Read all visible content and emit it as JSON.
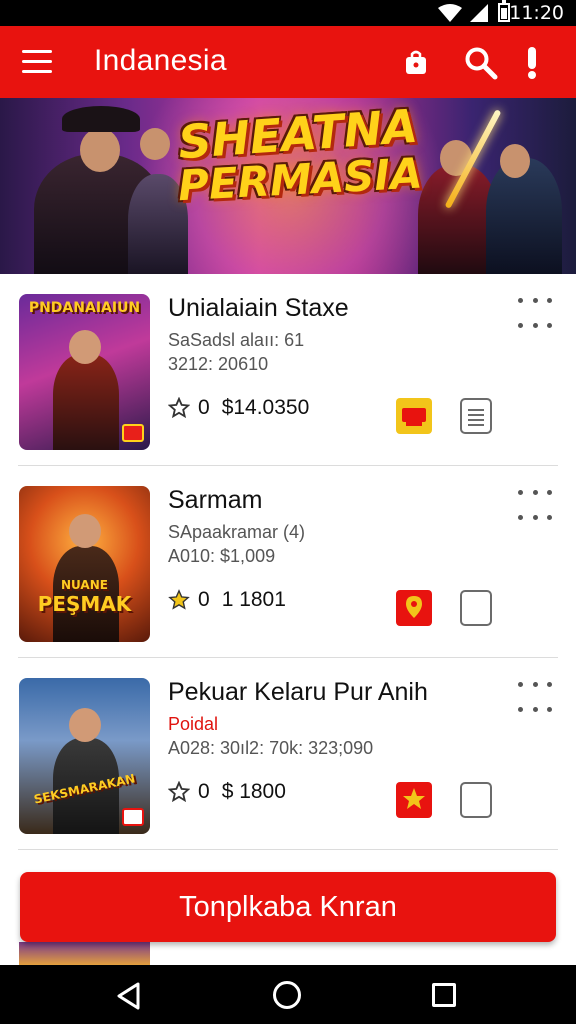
{
  "status_bar": {
    "time": "11:20"
  },
  "app_bar": {
    "title": "Indanesia"
  },
  "banner": {
    "title_line1": "SHEATNA",
    "title_line2": "PERMASIA"
  },
  "items": [
    {
      "name": "Unialaiain Staxe",
      "sub1": "SaSadsl alaıı: 61",
      "sub2": "3212: 20610",
      "rating": "0",
      "price": "$14.0350",
      "thumb_text": "PNDANAIAIUN"
    },
    {
      "name": "Sarmam",
      "sub1": "SApaakramar (4)",
      "sub2": "A010: $1,009",
      "rating": "0",
      "price": "1 1801",
      "thumb_text_line1": "NUANE",
      "thumb_text_line2": "PEŞMAK"
    },
    {
      "name": "Pekuar Kelaru Pur Anih",
      "sub1": "Poidal",
      "sub2": "A028: 30ıl2: 70k: 323;090",
      "rating": "0",
      "price": "$ 1800",
      "thumb_text": "SEKSMARAKAN"
    }
  ],
  "cta": {
    "label": "Tonplkaba Knran"
  },
  "colors": {
    "brand_red": "#e8130f",
    "star_yellow": "#f2c51a"
  },
  "icons": [
    "menu-icon",
    "bag-icon",
    "search-icon",
    "alert-icon",
    "star-icon",
    "store-icon",
    "document-icon",
    "more-icon",
    "back-icon",
    "home-icon",
    "recents-icon"
  ]
}
